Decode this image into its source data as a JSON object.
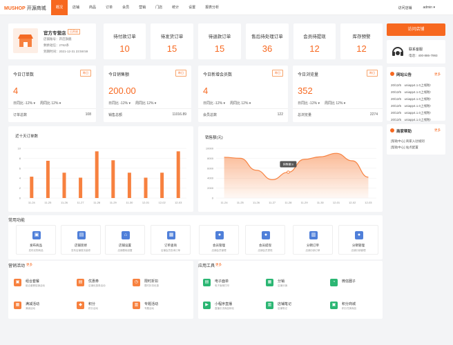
{
  "brand": {
    "logo": "MUSHOP",
    "name": "开源商城"
  },
  "nav": [
    "概况",
    "店铺",
    "商品",
    "订单",
    "会员",
    "营销",
    "门店",
    "统计",
    "设置",
    "报表分析"
  ],
  "topbar": {
    "visit": "访问店铺",
    "user": "admin ▾"
  },
  "store": {
    "name": "官方专营店",
    "badge": "已开启",
    "account": "店铺账号：开店旗舰",
    "balance": "剩余短信：2762条",
    "expire": "到期时间：2021-12-31 23:59:59"
  },
  "stats": [
    {
      "label": "待付款订单",
      "value": "10"
    },
    {
      "label": "待发货订单",
      "value": "15"
    },
    {
      "label": "待退款订单",
      "value": "15"
    },
    {
      "label": "售后待处理订单",
      "value": "36"
    },
    {
      "label": "会员待提现",
      "value": "12"
    },
    {
      "label": "库存预警",
      "value": "12"
    }
  ],
  "visit_button": "访问店铺",
  "service": {
    "label": "联系客服",
    "phone": "电话：400-886-7993"
  },
  "summaries": [
    {
      "title": "今日订单数",
      "tag": "昨日",
      "value": "4",
      "day": "日同比 -12% ▾",
      "week": "周同比 12% ▾",
      "foot_label": "订单总数",
      "foot_value": "108"
    },
    {
      "title": "今日销售额",
      "tag": "昨日",
      "value": "200.00",
      "day": "日同比 -12% ▾",
      "week": "周同比 12% ▾",
      "foot_label": "销售总额",
      "foot_value": "11016.89"
    },
    {
      "title": "今日新增会员数",
      "tag": "昨日",
      "value": "4",
      "day": "日同比 -12% ▾",
      "week": "周同比 12% ▾",
      "foot_label": "会员总数",
      "foot_value": "122"
    },
    {
      "title": "今日浏览量",
      "tag": "昨日",
      "value": "352",
      "day": "日同比 -12% ▾",
      "week": "周同比 12% ▾",
      "foot_label": "总浏览量",
      "foot_value": "2274"
    }
  ],
  "announcements": {
    "title": "网站公告",
    "more": "更多",
    "items": [
      "20/12/5　uniapp4.1.0上线啦!",
      "20/12/5　uniapp4.1.0上线啦!",
      "20/12/5　uniapp4.1.0上线啦!",
      "20/12/5　uniapp4.1.0上线啦!",
      "20/12/5　uniapp4.1.0上线啦!",
      "20/12/5　uniapp4.1.0上线啦!"
    ]
  },
  "help": {
    "title": "商家帮助",
    "more": "更多",
    "items": [
      "[帮助中心] 商家入驻规则",
      "[帮助中心] 站点配置"
    ]
  },
  "chart_data": [
    {
      "type": "bar",
      "title": "近十天订单数",
      "categories": [
        "11-24",
        "11-25",
        "11-26",
        "11-27",
        "11-28",
        "11-29",
        "11-30",
        "12-01",
        "12-02",
        "12-03"
      ],
      "values": [
        4.3,
        7.5,
        5.1,
        4.1,
        9.4,
        7.6,
        5.1,
        4.1,
        5.1,
        9.4
      ],
      "ylim": [
        0,
        10
      ],
      "yticks": [
        0,
        2,
        4,
        6,
        8,
        10
      ],
      "color": "#f7813f"
    },
    {
      "type": "area",
      "title": "销售额(元)",
      "categories": [
        "11-24",
        "11-25",
        "11-26",
        "11-27",
        "11-28",
        "11-29",
        "11-30",
        "12-01",
        "12-02",
        "12-03"
      ],
      "values": [
        8200,
        8000,
        5600,
        3700,
        5200,
        7800,
        8300,
        9000,
        7500,
        4200
      ],
      "ylim": [
        0,
        10000
      ],
      "yticks": [
        0,
        2000,
        4000,
        6000,
        8000,
        10000
      ],
      "tooltip": "销售额:6",
      "color": "#f7813f"
    }
  ],
  "common": {
    "title": "常用功能",
    "items": [
      {
        "name": "发布商品",
        "desc": "发布实物商品",
        "icon": "shirt-icon"
      },
      {
        "name": "店铺装修",
        "desc": "发布店铺首页装修",
        "icon": "file-icon"
      },
      {
        "name": "店铺设置",
        "desc": "店铺基础设置",
        "icon": "store-icon"
      },
      {
        "name": "订单查询",
        "desc": "店铺会员查询订单",
        "icon": "clipboard-icon"
      },
      {
        "name": "会员管理",
        "desc": "店铺会员管理",
        "icon": "user-icon"
      },
      {
        "name": "会员提现",
        "desc": "店铺会员提现",
        "icon": "user-icon"
      },
      {
        "name": "分销订单",
        "desc": "店铺分销订单",
        "icon": "document-icon"
      },
      {
        "name": "分销管理",
        "desc": "店铺分销管理",
        "icon": "user-icon"
      }
    ]
  },
  "marketing": {
    "title": "营销活动",
    "more": "更多",
    "items": [
      {
        "name": "组合套餐",
        "desc": "组合套餐促销活动",
        "color": "#f7813f",
        "icon": "package-icon"
      },
      {
        "name": "优惠券",
        "desc": "店铺优惠券活动",
        "color": "#f7813f",
        "icon": "coupon-icon"
      },
      {
        "name": "限时折扣",
        "desc": "限时折扣优惠",
        "color": "#f7813f",
        "icon": "clock-icon"
      },
      {
        "name": "满减活动",
        "desc": "满减活动",
        "color": "#f7813f",
        "icon": "gift-icon"
      },
      {
        "name": "积分",
        "desc": "积分活动",
        "color": "#f7813f",
        "icon": "points-icon"
      },
      {
        "name": "专题活动",
        "desc": "专题活动",
        "color": "#f7813f",
        "icon": "topic-icon"
      }
    ]
  },
  "tools": {
    "title": "应用工具",
    "more": "更多",
    "items": [
      {
        "name": "电子面单",
        "desc": "电子面单打印",
        "color": "#2bb673",
        "icon": "print-icon"
      },
      {
        "name": "分销",
        "desc": "店铺分销",
        "color": "#2bb673",
        "icon": "share-icon"
      },
      {
        "name": "微信圈子",
        "desc": "",
        "color": "#2bb673",
        "icon": "wechat-icon"
      },
      {
        "name": "小程序直播",
        "desc": "直播引流商品转化",
        "color": "#2bb673",
        "icon": "live-icon"
      },
      {
        "name": "店铺笔记",
        "desc": "店铺笔记",
        "color": "#2bb673",
        "icon": "note-icon"
      },
      {
        "name": "积分商城",
        "desc": "积分兑换商品",
        "color": "#2bb673",
        "icon": "mall-icon"
      }
    ]
  }
}
